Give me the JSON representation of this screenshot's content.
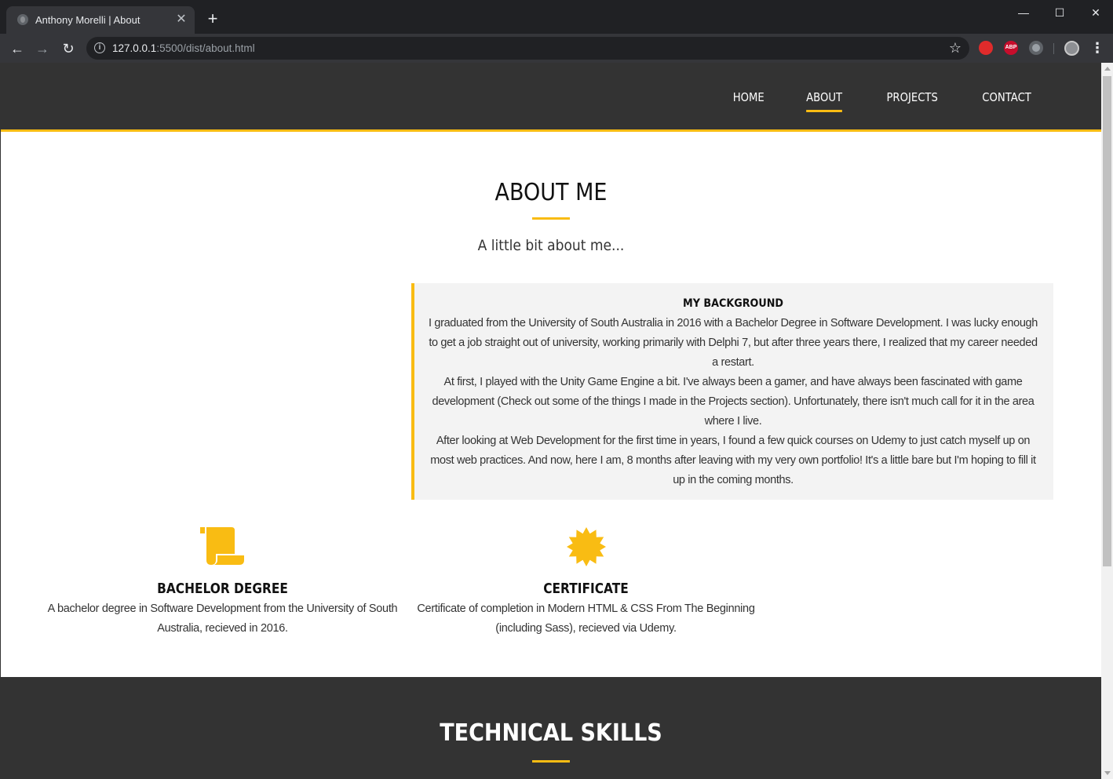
{
  "browser": {
    "tab_title": "Anthony Morelli | About",
    "tab_close": "✕",
    "new_tab": "+",
    "url_host": "127.0.0.1",
    "url_path": ":5500/dist/about.html",
    "window_controls": {
      "minimize": "—",
      "maximize": "☐",
      "close": "✕"
    },
    "extensions": [
      "adblock-stop-icon",
      "abp-icon",
      "circle-extension-icon"
    ],
    "abp_label": "ABP"
  },
  "nav": {
    "items": [
      {
        "label": "HOME",
        "active": false
      },
      {
        "label": "ABOUT",
        "active": true
      },
      {
        "label": "PROJECTS",
        "active": false
      },
      {
        "label": "CONTACT",
        "active": false
      }
    ]
  },
  "about": {
    "title": "ABOUT ME",
    "subtitle": "A little bit about me..."
  },
  "background": {
    "heading": "MY BACKGROUND",
    "paragraphs": [
      "I graduated from the University of South Australia in 2016 with a Bachelor Degree in Software Development. I was lucky enough to get a job straight out of university, working primarily with Delphi 7, but after three years there, I realized that my career needed a restart.",
      "At first, I played with the Unity Game Engine a bit. I've always been a gamer, and have always been fascinated with game development (Check out some of the things I made in the Projects section). Unfortunately, there isn't much call for it in the area where I live.",
      "After looking at Web Development for the first time in years, I found a few quick courses on Udemy to just catch myself up on most web practices. And now, here I am, 8 months after leaving with my very own portfolio! It's a little bare but I'm hoping to fill it up in the coming months."
    ]
  },
  "credentials": [
    {
      "icon": "scroll-icon",
      "title": "BACHELOR DEGREE",
      "text": "A bachelor degree in Software Development from the University of South Australia, recieved in 2016."
    },
    {
      "icon": "certificate-icon",
      "title": "CERTIFICATE",
      "text": "Certificate of completion in Modern HTML & CSS From The Beginning (including Sass), recieved via Udemy."
    }
  ],
  "skills": {
    "title": "TECHNICAL SKILLS"
  },
  "colors": {
    "accent": "#f9bc13",
    "header_bg": "#333333",
    "box_bg": "#f3f3f3"
  }
}
